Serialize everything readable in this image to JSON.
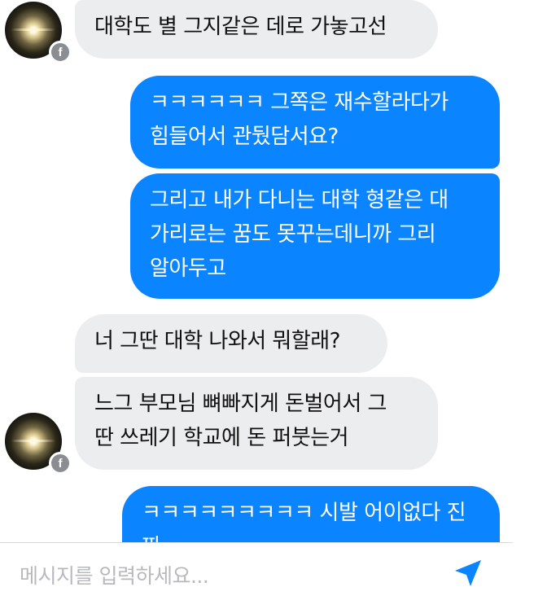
{
  "messages": [
    {
      "direction": "incoming",
      "lines": [
        "대학도 별 그지같은 데로 가놓고선"
      ]
    },
    {
      "direction": "outgoing",
      "lines": [
        "ㅋㅋㅋㅋㅋㅋ 그쪽은 재수할라다가",
        "힘들어서 관뒀담서요?"
      ]
    },
    {
      "direction": "outgoing",
      "lines": [
        "그리고 내가 다니는 대학 형같은 대",
        "가리로는 꿈도 못꾸는데니까 그리",
        "알아두고"
      ]
    },
    {
      "direction": "incoming",
      "lines": [
        "너 그딴 대학 나와서 뭐할래?"
      ]
    },
    {
      "direction": "incoming",
      "lines": [
        "느그 부모님 뼈빠지게 돈벌어서 그",
        "딴 쓰레기 학교에 돈 퍼붓는거"
      ]
    },
    {
      "direction": "outgoing",
      "lines": [
        "ㅋㅋㅋㅋㅋㅋㅋㅋㅋ 시발 어이없다 진",
        "짜"
      ]
    }
  ],
  "avatar_badge": "f",
  "composer": {
    "placeholder": "메시지를 입력하세요..."
  },
  "icons": {
    "avatar_badge": "facebook-icon",
    "send": "send-icon"
  },
  "colors": {
    "outgoing_bubble": "#0a84ff",
    "incoming_bubble": "#ecedef",
    "send_icon": "#0a84ff"
  }
}
